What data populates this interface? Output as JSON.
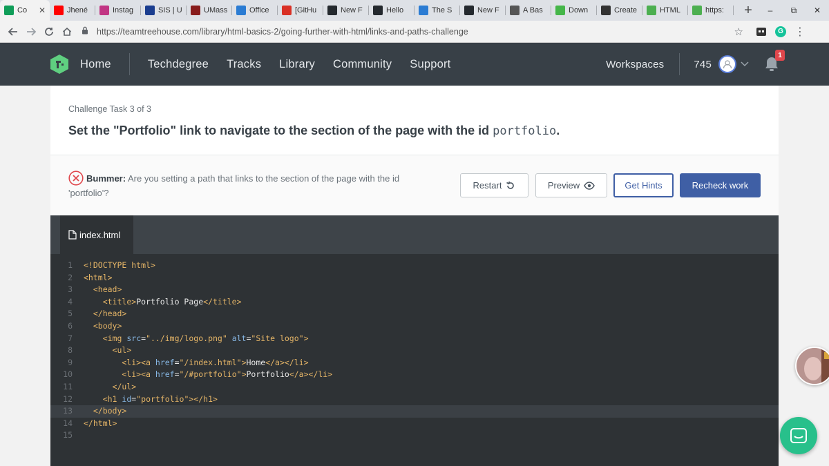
{
  "browser": {
    "tabs": [
      {
        "title": "Co",
        "favicon": "sheets-icon",
        "color": "#0f9d58",
        "active": true
      },
      {
        "title": "Jhené",
        "favicon": "youtube-icon",
        "color": "#ff0000"
      },
      {
        "title": "Instag",
        "favicon": "instagram-icon",
        "color": "#c13584"
      },
      {
        "title": "SIS | U",
        "favicon": "umass-icon",
        "color": "#1a3d8f"
      },
      {
        "title": "UMass",
        "favicon": "umass-icon",
        "color": "#881c1c"
      },
      {
        "title": "Office",
        "favicon": "office-icon",
        "color": "#2b7cd3"
      },
      {
        "title": "[GitHu",
        "favicon": "gmail-icon",
        "color": "#d93025"
      },
      {
        "title": "New F",
        "favicon": "github-icon",
        "color": "#24292e"
      },
      {
        "title": "Hello",
        "favicon": "github-icon",
        "color": "#24292e"
      },
      {
        "title": "The S",
        "favicon": "page-icon",
        "color": "#2b7cd3"
      },
      {
        "title": "New F",
        "favicon": "github-icon",
        "color": "#24292e"
      },
      {
        "title": "A Bas",
        "favicon": "diamond-icon",
        "color": "#555555"
      },
      {
        "title": "Down",
        "favicon": "leaf-icon",
        "color": "#45b649"
      },
      {
        "title": "Create",
        "favicon": "p-icon",
        "color": "#333333"
      },
      {
        "title": "HTML",
        "favicon": "w3-icon",
        "color": "#4caf50"
      },
      {
        "title": "https:",
        "favicon": "w3-icon",
        "color": "#4caf50"
      }
    ],
    "new_tab": "+",
    "window_controls": [
      "–",
      "⧉",
      "✕"
    ],
    "url": "https://teamtreehouse.com/library/html-basics-2/going-further-with-html/links-and-paths-challenge"
  },
  "header": {
    "nav": [
      "Home",
      "Techdegree",
      "Tracks",
      "Library",
      "Community",
      "Support"
    ],
    "workspaces": "Workspaces",
    "points": "745",
    "notification_count": "1",
    "colors": {
      "bg": "#384047",
      "logo": "#5fcf80"
    }
  },
  "challenge": {
    "task_label": "Challenge Task 3 of 3",
    "task_text_before": "Set the \"Portfolio\" link to navigate to the section of the page with the id ",
    "task_code": "portfolio",
    "task_text_after": ".",
    "error_title": "Bummer:",
    "error_message": "Are you setting a path that links to the section of the page with the id 'portfolio'?",
    "buttons": {
      "restart": "Restart",
      "preview": "Preview",
      "hints": "Get Hints",
      "recheck": "Recheck work"
    },
    "accent": "#3f5fa5",
    "error_color": "#e0474c"
  },
  "editor": {
    "file_tab": "index.html",
    "lines": [
      "<!DOCTYPE html>",
      "<html>",
      "  <head>",
      "    <title>Portfolio Page</title>",
      "  </head>",
      "  <body>",
      "    <img src=\"../img/logo.png\" alt=\"Site logo\">",
      "      <ul>",
      "        <li><a href=\"/index.html\">Home</a></li>",
      "        <li><a href=\"/#portfolio\">Portfolio</a></li>",
      "      </ul>",
      "    <h1 id=\"portfolio\"></h1>",
      "  </body>",
      "</html>",
      ""
    ],
    "highlighted_line": 13
  }
}
